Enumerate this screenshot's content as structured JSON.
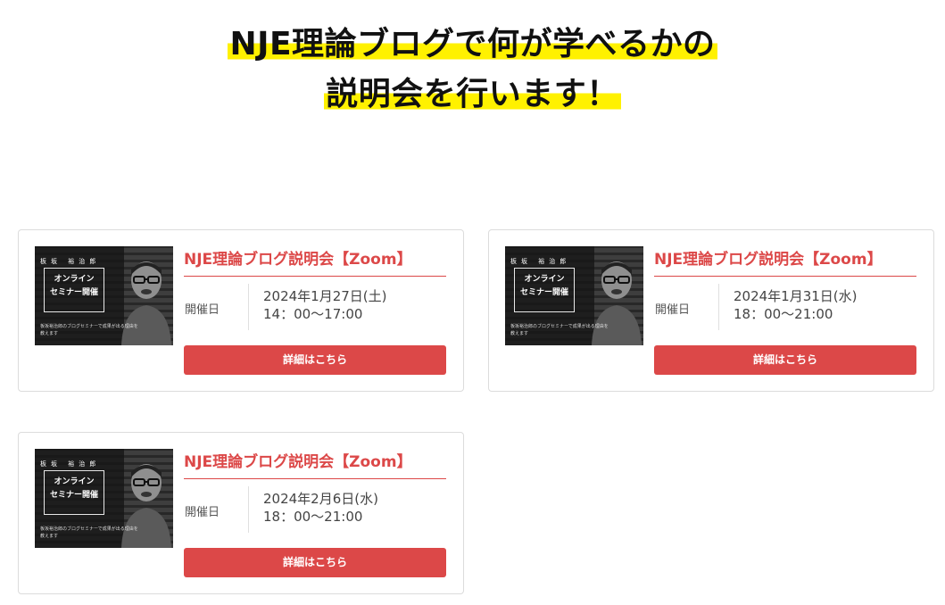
{
  "heading": {
    "line1": "NJE理論ブログで何が学べるかの",
    "line2": "説明会を行います！"
  },
  "thumbnail": {
    "name": "板坂 裕治郎",
    "title_line1": "オンライン",
    "title_line2": "セミナー開催",
    "subtitle": "板坂裕治郎のブログセミナーで成果が出る理由を教えます"
  },
  "events": [
    {
      "title": "NJE理論ブログ説明会【Zoom】",
      "date_label": "開催日",
      "date": "2024年1月27日(土)",
      "time": "14：00〜17:00",
      "button_label": "詳細はこちら"
    },
    {
      "title": "NJE理論ブログ説明会【Zoom】",
      "date_label": "開催日",
      "date": "2024年1月31日(水)",
      "time": "18：00〜21:00",
      "button_label": "詳細はこちら"
    },
    {
      "title": "NJE理論ブログ説明会【Zoom】",
      "date_label": "開催日",
      "date": "2024年2月6日(水)",
      "time": "18：00〜21:00",
      "button_label": "詳細はこちら"
    }
  ],
  "colors": {
    "accent": "#dc4848",
    "highlight": "#fff100"
  }
}
